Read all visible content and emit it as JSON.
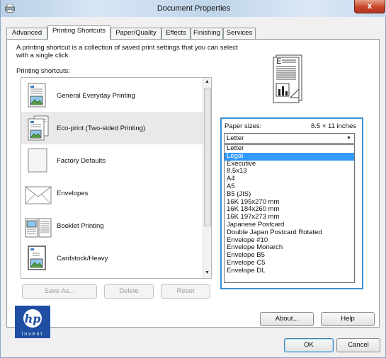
{
  "window": {
    "title": "Document Properties",
    "close_glyph": "x"
  },
  "tabs": [
    {
      "label": "Advanced"
    },
    {
      "label": "Printing Shortcuts"
    },
    {
      "label": "Paper/Quality"
    },
    {
      "label": "Effects"
    },
    {
      "label": "Finishing"
    },
    {
      "label": "Services"
    }
  ],
  "active_tab": "Printing Shortcuts",
  "description_line1": "A printing shortcut is a collection of saved print settings that you can select",
  "description_line2": "with a single click.",
  "shortcuts_label": "Printing shortcuts:",
  "shortcuts": [
    {
      "label": "General Everyday Printing",
      "icon": "document-landscape-icon"
    },
    {
      "label": "Eco-print (Two-sided Printing)",
      "icon": "duplex-document-icon",
      "selected": true
    },
    {
      "label": "Factory Defaults",
      "icon": "blank-document-icon"
    },
    {
      "label": "Envelopes",
      "icon": "envelope-icon"
    },
    {
      "label": "Booklet Printing",
      "icon": "booklet-icon"
    },
    {
      "label": "Cardstock/Heavy",
      "icon": "cardstock-icon"
    }
  ],
  "buttons": {
    "save_as": "Save As...",
    "delete": "Delete",
    "reset": "Reset",
    "about": "About...",
    "help": "Help",
    "ok": "OK",
    "cancel": "Cancel"
  },
  "paper": {
    "label": "Paper sizes:",
    "dimensions": "8.5 × 11 inches",
    "selected": "Letter",
    "highlighted": "Legal",
    "options": [
      "Letter",
      "Legal",
      "Executive",
      "8.5x13",
      "A4",
      "A5",
      "B5 (JIS)",
      "16K 195x270 mm",
      "16K 184x260 mm",
      "16K 197x273 mm",
      "Japanese Postcard",
      "Double Japan Postcard Rotated",
      "Envelope #10",
      "Envelope Monarch",
      "Envelope B5",
      "Envelope C5",
      "Envelope DL"
    ]
  },
  "logo": {
    "text": "hp",
    "tagline": "invent"
  },
  "colors": {
    "highlight": "#3399ff",
    "panel_border": "#3d8fd1",
    "hp_blue": "#1f4fa3"
  }
}
